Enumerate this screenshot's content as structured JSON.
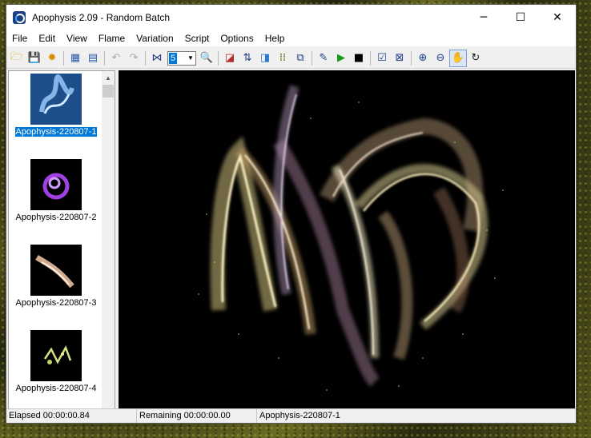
{
  "window": {
    "title": "Apophysis 2.09 - Random Batch"
  },
  "window_controls": {
    "minimize": "─",
    "maximize": "☐",
    "close": "✕"
  },
  "menu": [
    "File",
    "Edit",
    "View",
    "Flame",
    "Variation",
    "Script",
    "Options",
    "Help"
  ],
  "toolbar": {
    "quality_value": "5"
  },
  "sidebar": {
    "items": [
      {
        "label": "Apophysis-220807-1",
        "selected": true
      },
      {
        "label": "Apophysis-220807-2",
        "selected": false
      },
      {
        "label": "Apophysis-220807-3",
        "selected": false
      },
      {
        "label": "Apophysis-220807-4",
        "selected": false
      }
    ]
  },
  "status": {
    "elapsed": "Elapsed 00:00:00.84",
    "remaining": "Remaining 00:00:00.00",
    "flame_name": "Apophysis-220807-1"
  }
}
